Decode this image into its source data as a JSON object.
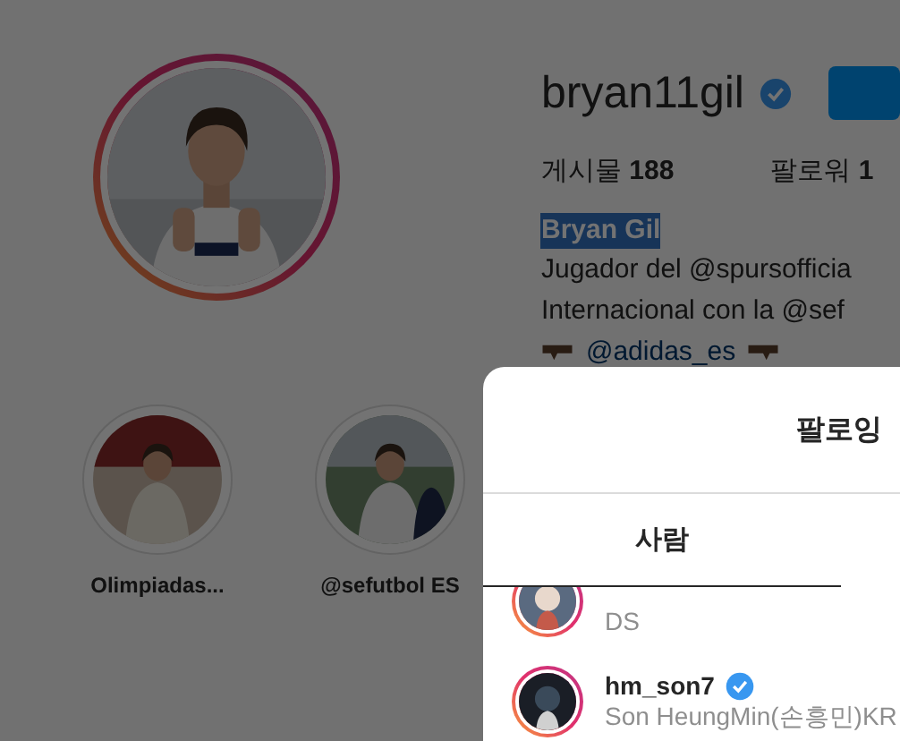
{
  "profile": {
    "username": "bryan11gil",
    "verified": true,
    "stats": [
      {
        "label": "게시물",
        "value": "188"
      },
      {
        "label": "팔로워",
        "value": "1"
      }
    ],
    "full_name": "Bryan Gil",
    "name_selected": true,
    "bio": [
      "Jugador del @spursofficia",
      "Internacional con la @sef"
    ],
    "bio_sponsor": "@adidas_es"
  },
  "highlights": [
    {
      "label": "Olimpiadas..."
    },
    {
      "label": "@sefutbol ES"
    }
  ],
  "modal": {
    "title": "팔로잉",
    "tabs": [
      {
        "label": "사람",
        "selected": true
      }
    ],
    "accounts": [
      {
        "subtitle": "DS",
        "story_ring": true
      },
      {
        "username": "hm_son7",
        "verified": true,
        "subtitle": "Son HeungMin(손흥민)KR",
        "story_ring": true
      }
    ]
  }
}
